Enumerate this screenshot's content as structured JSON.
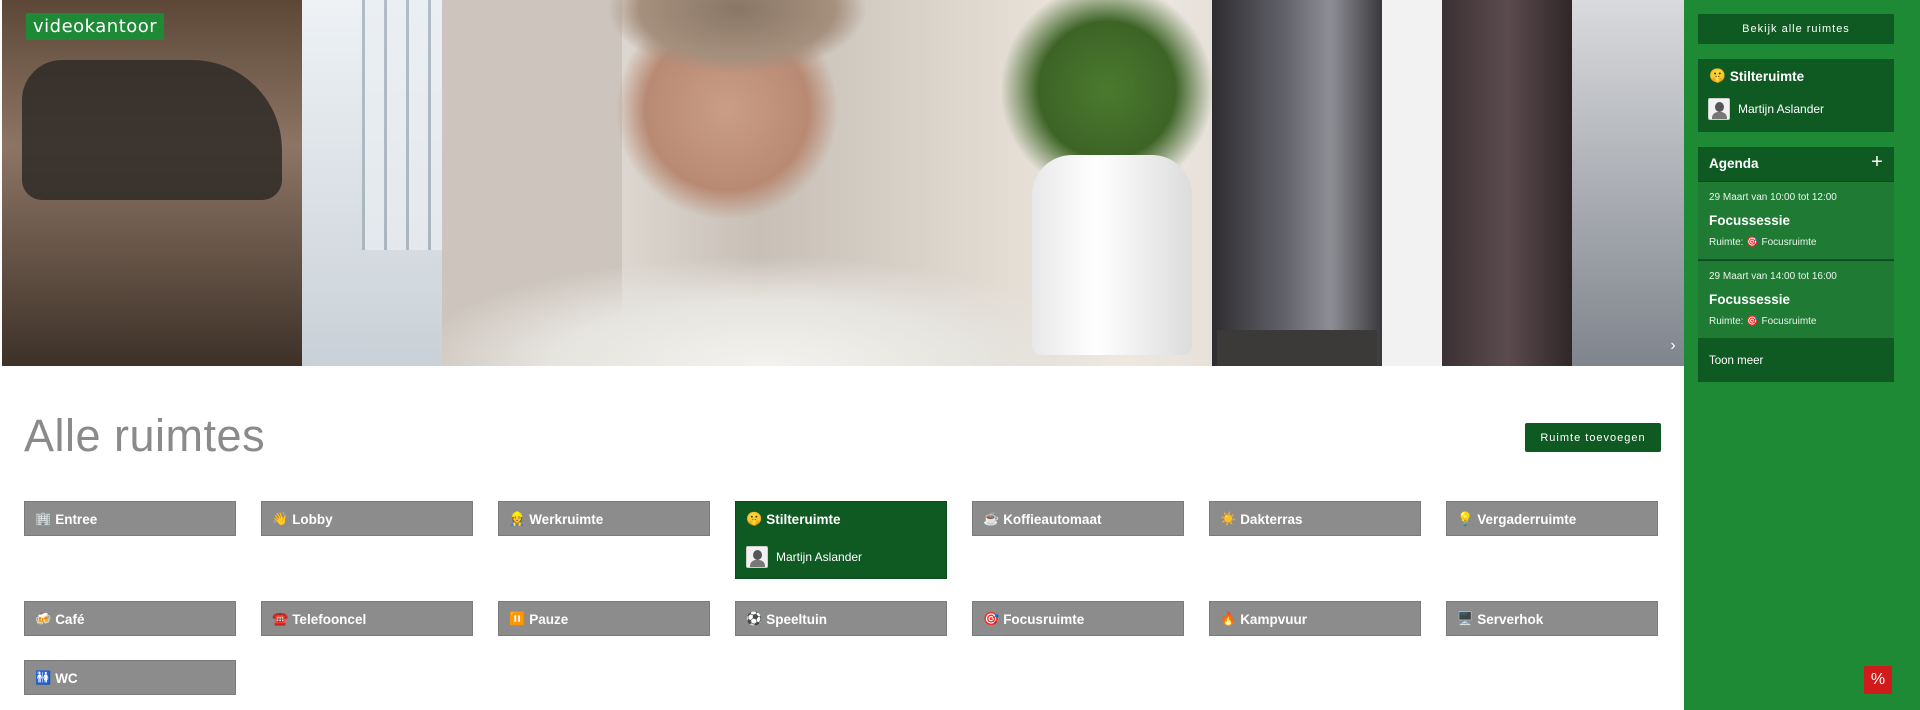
{
  "brand": "videokantoor",
  "video": {
    "next_icon": "chevron-right-icon"
  },
  "page_title": "Alle ruimtes",
  "add_room_button": "Ruimte toevoegen",
  "rooms": [
    {
      "emoji": "🏢",
      "name": "Entree"
    },
    {
      "emoji": "👋",
      "name": "Lobby"
    },
    {
      "emoji": "👷",
      "name": "Werkruimte"
    },
    {
      "emoji": "🤫",
      "name": "Stilteruimte",
      "active": true,
      "members": [
        "Martijn Aslander"
      ]
    },
    {
      "emoji": "☕",
      "name": "Koffieautomaat"
    },
    {
      "emoji": "☀️",
      "name": "Dakterras"
    },
    {
      "emoji": "💡",
      "name": "Vergaderruimte"
    },
    {
      "emoji": "🍻",
      "name": "Café"
    },
    {
      "emoji": "☎️",
      "name": "Telefooncel"
    },
    {
      "emoji": "⏸️",
      "name": "Pauze"
    },
    {
      "emoji": "⚽",
      "name": "Speeltuin"
    },
    {
      "emoji": "🎯",
      "name": "Focusruimte"
    },
    {
      "emoji": "🔥",
      "name": "Kampvuur"
    },
    {
      "emoji": "🖥️",
      "name": "Serverhok"
    },
    {
      "emoji": "🚻",
      "name": "WC"
    }
  ],
  "sidebar": {
    "view_all_button": "Bekijk alle ruimtes",
    "current_room": {
      "emoji": "🤫",
      "name": "Stilteruimte",
      "member": "Martijn Aslander"
    },
    "agenda": {
      "title": "Agenda",
      "add_icon": "+",
      "items": [
        {
          "time": "29 Maart van 10:00 tot 12:00",
          "name": "Focussessie",
          "room_label": "Ruimte:",
          "room_emoji": "🎯",
          "room": "Focusruimte"
        },
        {
          "time": "29 Maart van 14:00 tot 16:00",
          "name": "Focussessie",
          "room_label": "Ruimte:",
          "room_emoji": "🎯",
          "room": "Focusruimte"
        }
      ],
      "show_more": "Toon meer"
    }
  },
  "colors": {
    "sidebar": "#1f8a36",
    "dark_green": "#0f5a23",
    "room_grey": "#8c8c8c",
    "badge": "#1f8a36",
    "tools": "#d11a1a"
  }
}
